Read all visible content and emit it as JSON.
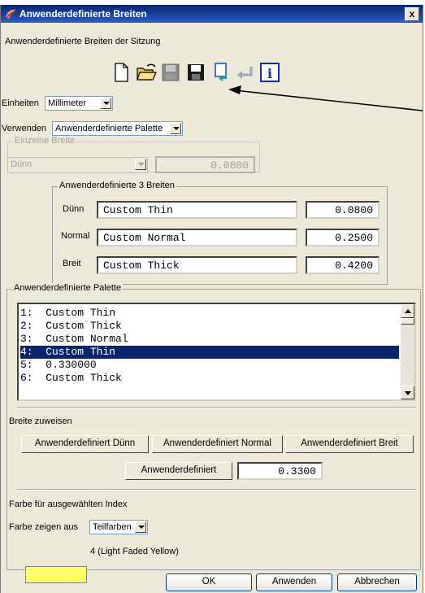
{
  "window": {
    "title": "Anwenderdefinierte Breiten",
    "close": "x"
  },
  "session_label": "Anwenderdefinierte Breiten der Sitzung",
  "toolbar": [
    "new-file-icon",
    "open-folder-icon",
    "save-icon",
    "save-as-icon",
    "export-icon",
    "undo-icon",
    "info-icon"
  ],
  "units": {
    "label": "Einheiten",
    "value": "Millimeter"
  },
  "use": {
    "label": "Verwenden",
    "value": "Anwenderdefinierte Palette"
  },
  "single_width": {
    "legend": "Einzelne Breite",
    "value": "Dünn",
    "number": "0.0800"
  },
  "custom3": {
    "legend": "Anwenderdefinierte 3 Breiten",
    "rows": [
      {
        "label": "Dünn",
        "name": "Custom Thin",
        "value": "0.0800"
      },
      {
        "label": "Normal",
        "name": "Custom Normal",
        "value": "0.2500"
      },
      {
        "label": "Breit",
        "name": "Custom Thick",
        "value": "0.4200"
      }
    ]
  },
  "palette": {
    "legend": "Anwenderdefinierte Palette",
    "items": [
      "1:  Custom Thin",
      "2:  Custom Thick",
      "3:  Custom Normal",
      "4:  Custom Thin",
      "5:  0.330000",
      "6:  Custom Thick"
    ],
    "selected_index": 3
  },
  "assign": {
    "label": "Breite zuweisen",
    "btn_thin": "Anwenderdefiniert Dünn",
    "btn_normal": "Anwenderdefiniert Normal",
    "btn_thick": "Anwenderdefiniert Breit",
    "btn_custom": "Anwenderdefiniert",
    "custom_value": "0.3300"
  },
  "color": {
    "heading": "Farbe für ausgewählten Index",
    "show_label": "Farbe zeigen aus",
    "show_value": "Teilfarben",
    "swatch_color": "#ffff66",
    "swatch_label": "4 (Light Faded Yellow)"
  },
  "footer": {
    "ok": "OK",
    "apply": "Anwenden",
    "cancel": "Abbrechen"
  }
}
